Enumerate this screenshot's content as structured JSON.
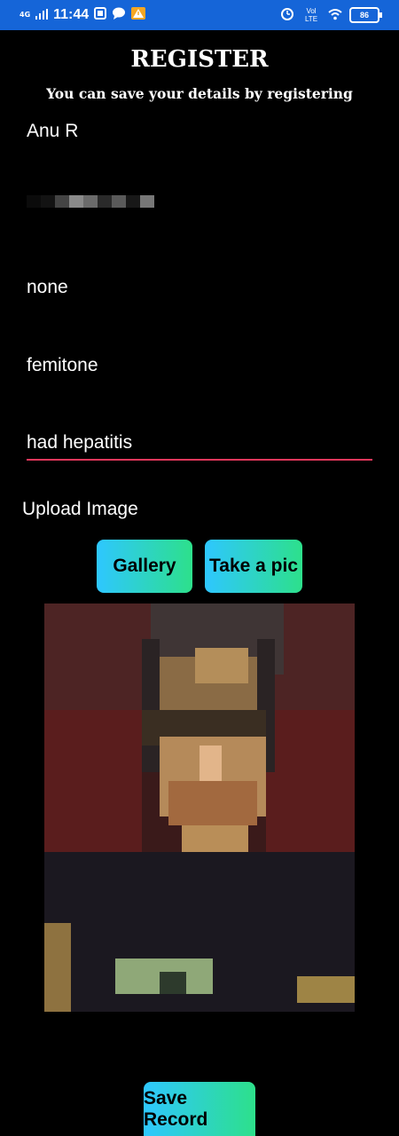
{
  "status_bar": {
    "network": "4G",
    "time": "11:44",
    "lte": "Vol LTE",
    "battery": "86"
  },
  "header": {
    "title": "REGISTER",
    "subtitle": "You can save your details by registering"
  },
  "fields": {
    "name": "Anu R",
    "allergies": "none",
    "medication": "femitone",
    "history": "had hepatitis"
  },
  "upload": {
    "label": "Upload Image",
    "gallery_button": "Gallery",
    "camera_button": "Take a pic"
  },
  "actions": {
    "save_button": "Save Record"
  }
}
